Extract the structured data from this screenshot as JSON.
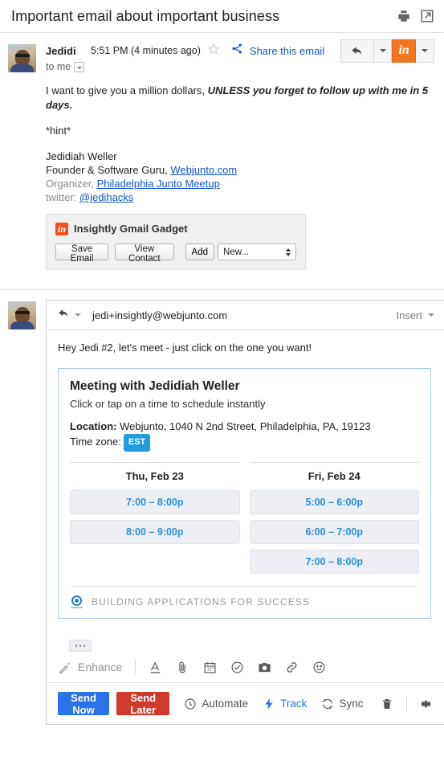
{
  "header": {
    "subject": "Important email about important business",
    "icons": [
      "print-icon",
      "popout-icon"
    ]
  },
  "message": {
    "sender": "Jedidiah Weller",
    "sender_display": "Jedidi",
    "timestamp": "5:51 PM (4 minutes ago)",
    "recipients": "to me",
    "share_label": "Share this email",
    "actions": {
      "reply": "reply-icon",
      "insightly": "in"
    },
    "body": {
      "line1_plain": "I want to give you a million dollars, ",
      "line1_bold": "UNLESS you forget to follow up with me in 5 days.",
      "hint": "*hint*",
      "sig_name": "Jedidiah Weller",
      "sig_role_plain": "Founder & Software Guru, ",
      "sig_role_link": "Webjunto.com",
      "sig_org_plain": "Organizer, ",
      "sig_org_link": "Philadelphia Junto Meetup",
      "sig_twitter_plain": "twitter: ",
      "sig_twitter_link": "@jedihacks"
    }
  },
  "gadget": {
    "title": "Insightly Gmail Gadget",
    "badge": "in",
    "save_email": "Save Email",
    "view_contact": "View Contact",
    "add": "Add",
    "select_value": "New..."
  },
  "compose": {
    "recipient": "jedi+insightly@webjunto.com",
    "insert_label": "Insert",
    "body_text": "Hey Jedi #2, let's meet - just click on the one you want!"
  },
  "scheduler": {
    "title": "Meeting with Jedidiah Weller",
    "subtitle": "Click or tap on a time to schedule instantly",
    "location_label": "Location:",
    "location_value": " Webjunto, 1040 N 2nd Street, Philadelphia, PA, 19123",
    "timezone_label": "Time zone:",
    "timezone_value": "EST",
    "timezone_color": "#1f9bde",
    "days": [
      {
        "label": "Thu, Feb 23",
        "slots": [
          "7:00 – 8:00p",
          "8:00 – 9:00p"
        ]
      },
      {
        "label": "Fri, Feb 24",
        "slots": [
          "5:00 – 6:00p",
          "6:00 – 7:00p",
          "7:00 – 8:00p"
        ]
      }
    ],
    "footer_text": "BUILDING APPLICATIONS FOR SUCCESS",
    "slot_color": "#2e8fd4"
  },
  "format_toolbar": {
    "enhance_label": "Enhance",
    "icons": [
      "font-icon",
      "attachment-icon",
      "calendar-icon",
      "check-circle-icon",
      "camera-icon",
      "link-icon",
      "emoji-icon"
    ]
  },
  "send_toolbar": {
    "send_now": "Send Now",
    "send_now_color": "#2b72e8",
    "send_later": "Send Later",
    "send_later_color": "#cf3b2b",
    "automate": "Automate",
    "track": "Track",
    "track_color": "#2b72e8",
    "sync": "Sync"
  }
}
